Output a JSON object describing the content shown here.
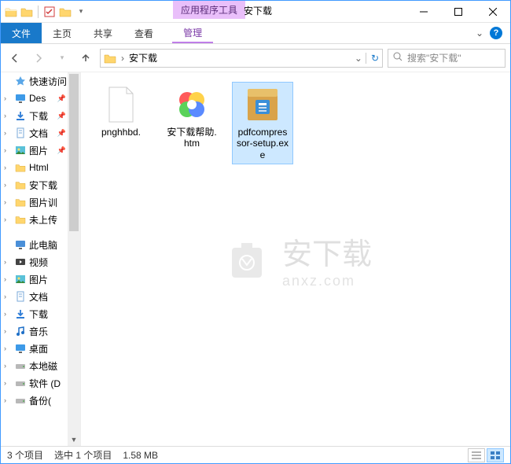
{
  "titlebar": {
    "context_tab": "应用程序工具",
    "title": "安下载"
  },
  "ribbon": {
    "file": "文件",
    "tabs": [
      "主页",
      "共享",
      "查看"
    ],
    "context_tab": "管理"
  },
  "addr": {
    "current": "安下载"
  },
  "search": {
    "placeholder": "搜索\"安下载\""
  },
  "sidebar": {
    "quick_access": "快速访问",
    "items": [
      {
        "label": "Des",
        "icon": "desktop",
        "pinned": true
      },
      {
        "label": "下载",
        "icon": "download",
        "pinned": true
      },
      {
        "label": "文档",
        "icon": "document",
        "pinned": true
      },
      {
        "label": "图片",
        "icon": "picture",
        "pinned": true
      },
      {
        "label": "Html",
        "icon": "folder"
      },
      {
        "label": "安下载",
        "icon": "folder"
      },
      {
        "label": "图片训",
        "icon": "folder"
      },
      {
        "label": "未上传",
        "icon": "folder"
      }
    ],
    "this_pc": "此电脑",
    "pc_items": [
      {
        "label": "视频",
        "icon": "video"
      },
      {
        "label": "图片",
        "icon": "picture"
      },
      {
        "label": "文档",
        "icon": "document"
      },
      {
        "label": "下载",
        "icon": "download"
      },
      {
        "label": "音乐",
        "icon": "music"
      },
      {
        "label": "桌面",
        "icon": "desktop"
      },
      {
        "label": "本地磁",
        "icon": "drive"
      },
      {
        "label": "软件 (D",
        "icon": "drive"
      },
      {
        "label": "备份(",
        "icon": "drive"
      }
    ]
  },
  "files": [
    {
      "name": "pnghhbd.",
      "icon": "blank",
      "selected": false
    },
    {
      "name": "安下载帮助.htm",
      "icon": "htm",
      "selected": false
    },
    {
      "name": "pdfcompressor-setup.exe",
      "icon": "exe",
      "selected": true
    }
  ],
  "watermark": {
    "main": "安下载",
    "sub": "anxz.com"
  },
  "status": {
    "count": "3 个项目",
    "selection": "选中 1 个项目",
    "size": "1.58 MB"
  }
}
